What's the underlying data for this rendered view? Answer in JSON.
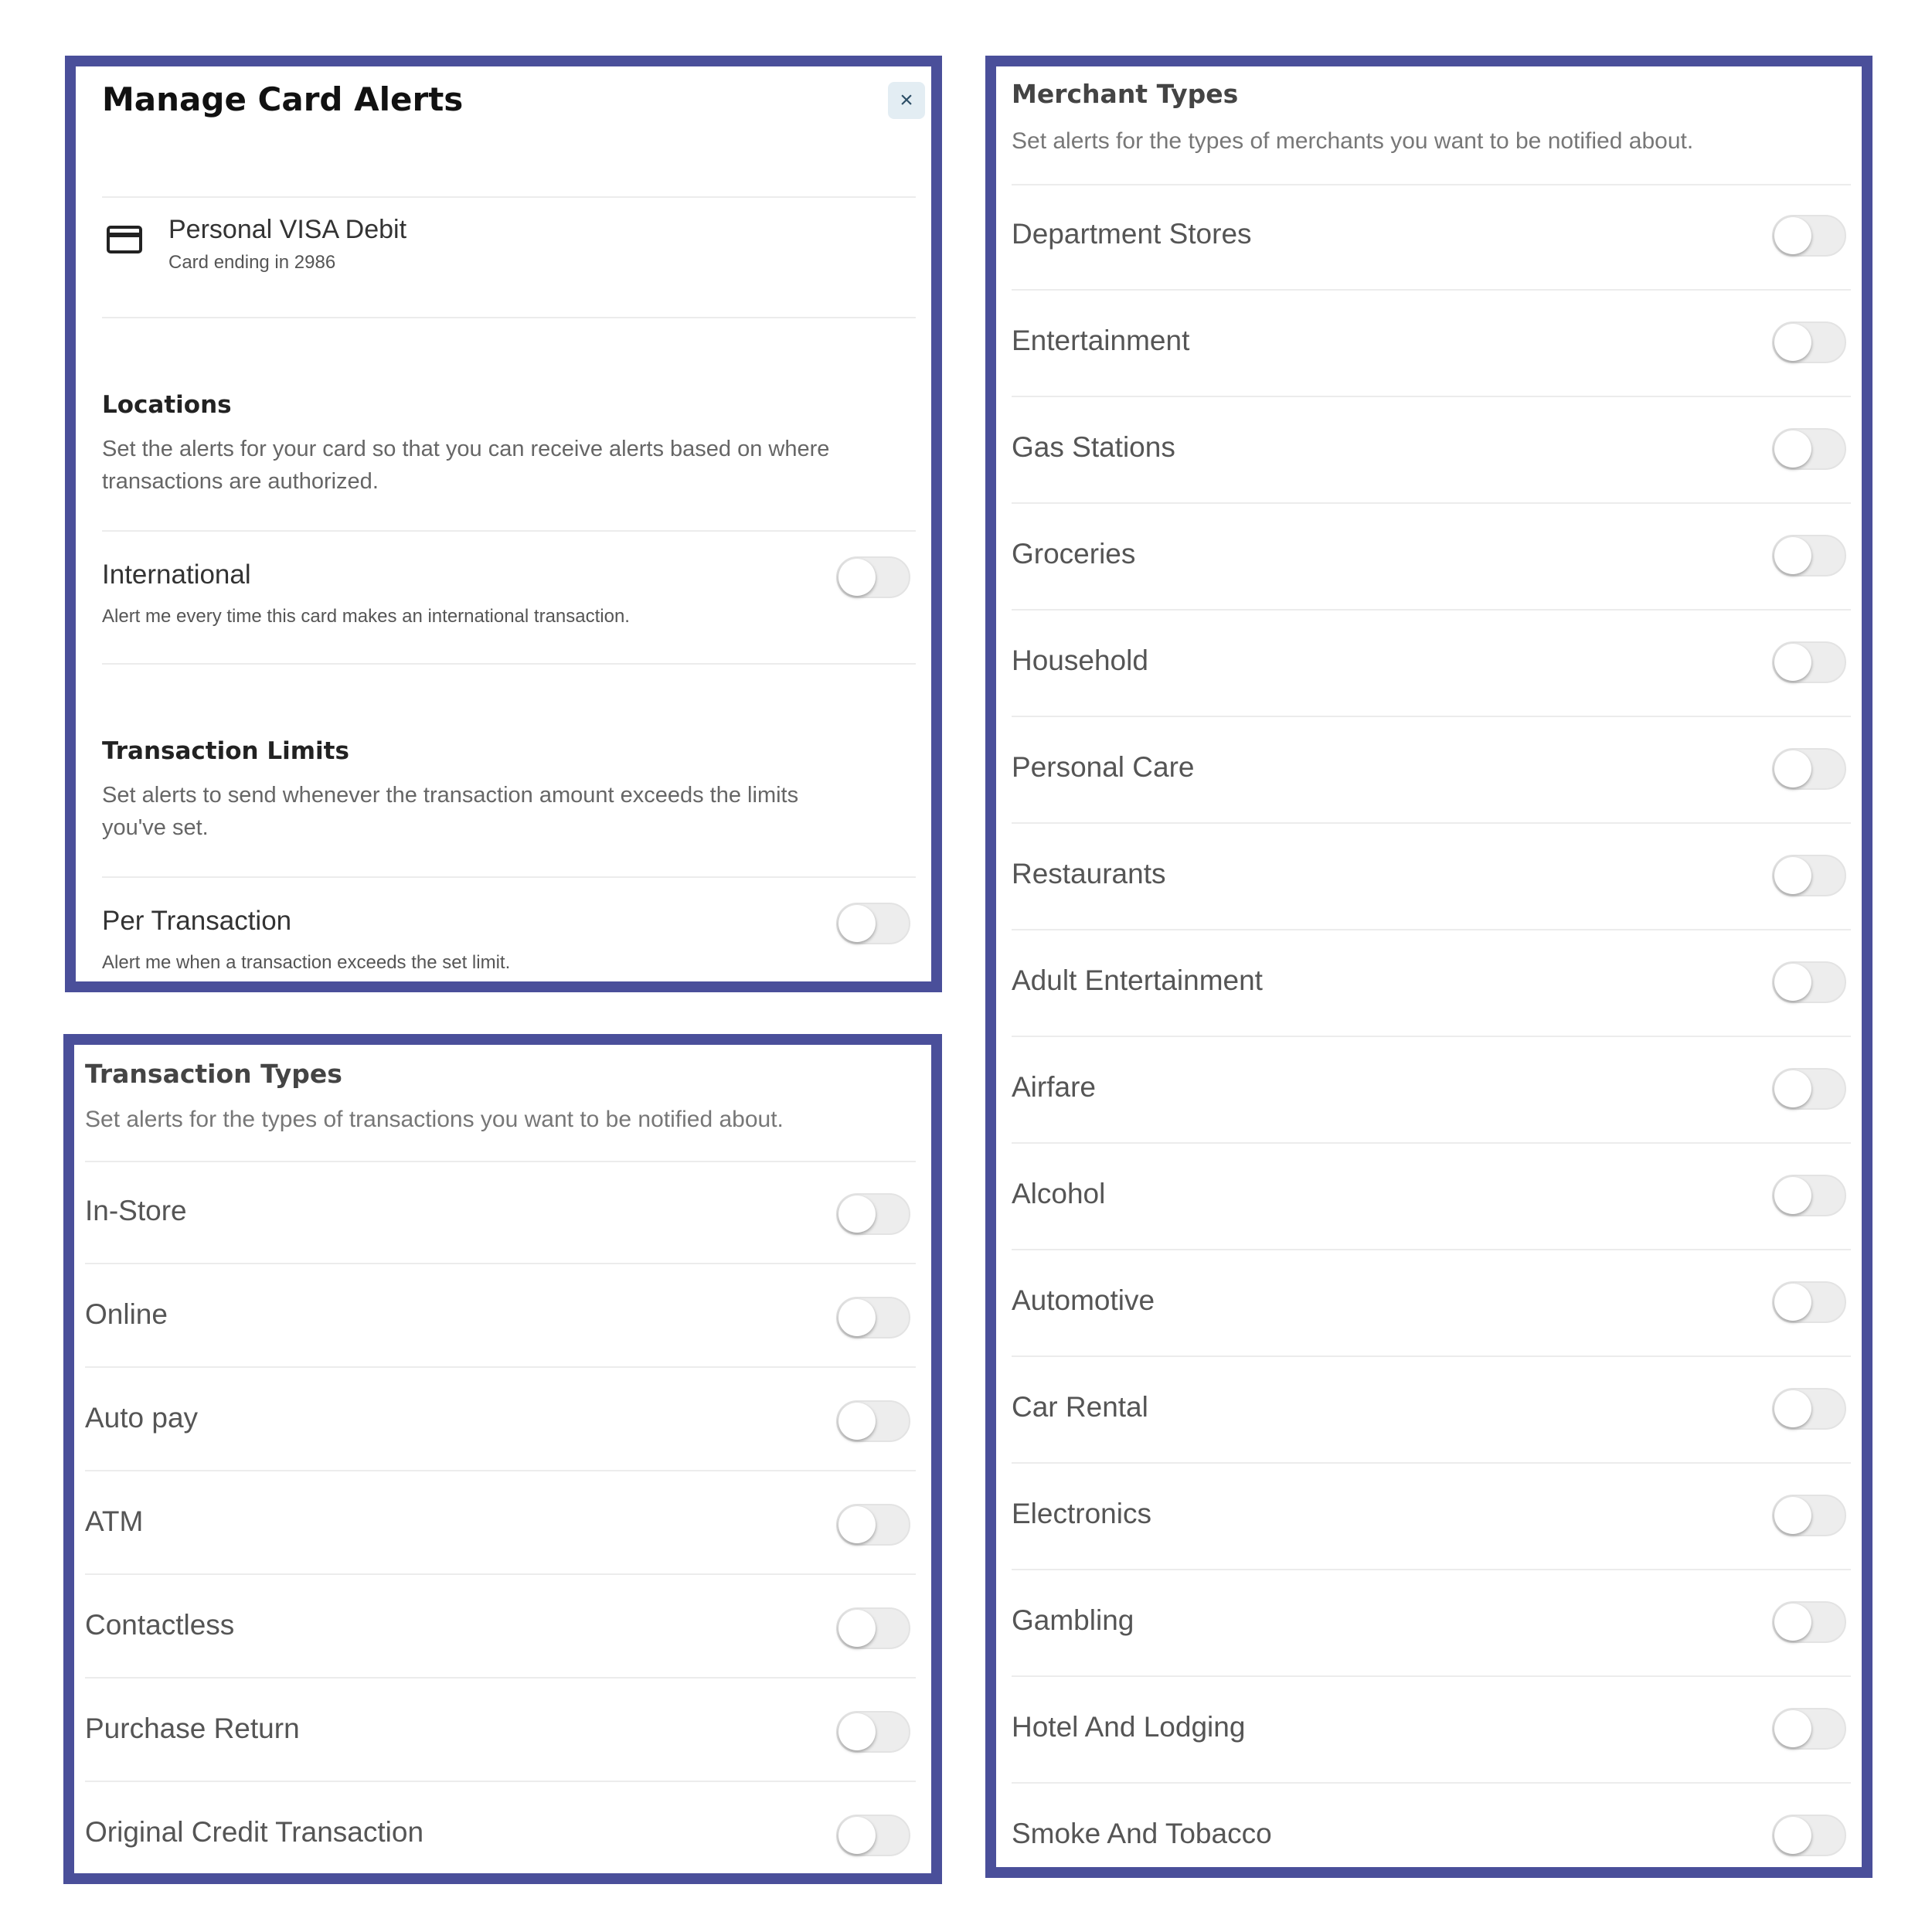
{
  "card_alerts": {
    "title": "Manage Card Alerts",
    "close_glyph": "×",
    "card": {
      "icon": "credit-card-icon",
      "name": "Personal VISA Debit",
      "subtitle": "Card ending in 2986"
    },
    "locations": {
      "title": "Locations",
      "description_line1": "Set the alerts for your card so that you can receive alerts based on where",
      "description_line2": "transactions are authorized.",
      "items": [
        {
          "label": "International",
          "subtitle": "Alert me every time this card makes an international transaction.",
          "enabled": false
        }
      ]
    },
    "transaction_limits": {
      "title": "Transaction Limits",
      "description_line1": "Set alerts to send whenever the transaction amount exceeds the limits",
      "description_line2": "you've set.",
      "items": [
        {
          "label": "Per Transaction",
          "subtitle": "Alert me when a transaction exceeds the set limit.",
          "enabled": false
        }
      ]
    }
  },
  "transaction_types": {
    "title": "Transaction Types",
    "description": "Set alerts for the types of transactions you want to be notified about.",
    "items": [
      {
        "label": "In-Store",
        "enabled": false
      },
      {
        "label": "Online",
        "enabled": false
      },
      {
        "label": "Auto pay",
        "enabled": false
      },
      {
        "label": "ATM",
        "enabled": false
      },
      {
        "label": "Contactless",
        "enabled": false
      },
      {
        "label": "Purchase Return",
        "enabled": false
      },
      {
        "label": "Original Credit Transaction",
        "enabled": false
      }
    ]
  },
  "merchant_types": {
    "title": "Merchant Types",
    "description": "Set alerts for the types of merchants you want to be notified about.",
    "items": [
      {
        "label": "Department Stores",
        "enabled": false
      },
      {
        "label": "Entertainment",
        "enabled": false
      },
      {
        "label": "Gas Stations",
        "enabled": false
      },
      {
        "label": "Groceries",
        "enabled": false
      },
      {
        "label": "Household",
        "enabled": false
      },
      {
        "label": "Personal Care",
        "enabled": false
      },
      {
        "label": "Restaurants",
        "enabled": false
      },
      {
        "label": "Adult Entertainment",
        "enabled": false
      },
      {
        "label": "Airfare",
        "enabled": false
      },
      {
        "label": "Alcohol",
        "enabled": false
      },
      {
        "label": "Automotive",
        "enabled": false
      },
      {
        "label": "Car Rental",
        "enabled": false
      },
      {
        "label": "Electronics",
        "enabled": false
      },
      {
        "label": "Gambling",
        "enabled": false
      },
      {
        "label": "Hotel And Lodging",
        "enabled": false
      },
      {
        "label": "Smoke And Tobacco",
        "enabled": false
      }
    ]
  },
  "colors": {
    "panel_border": "#4a4f9a",
    "toggle_off": "#ededed",
    "divider": "#ececec"
  }
}
